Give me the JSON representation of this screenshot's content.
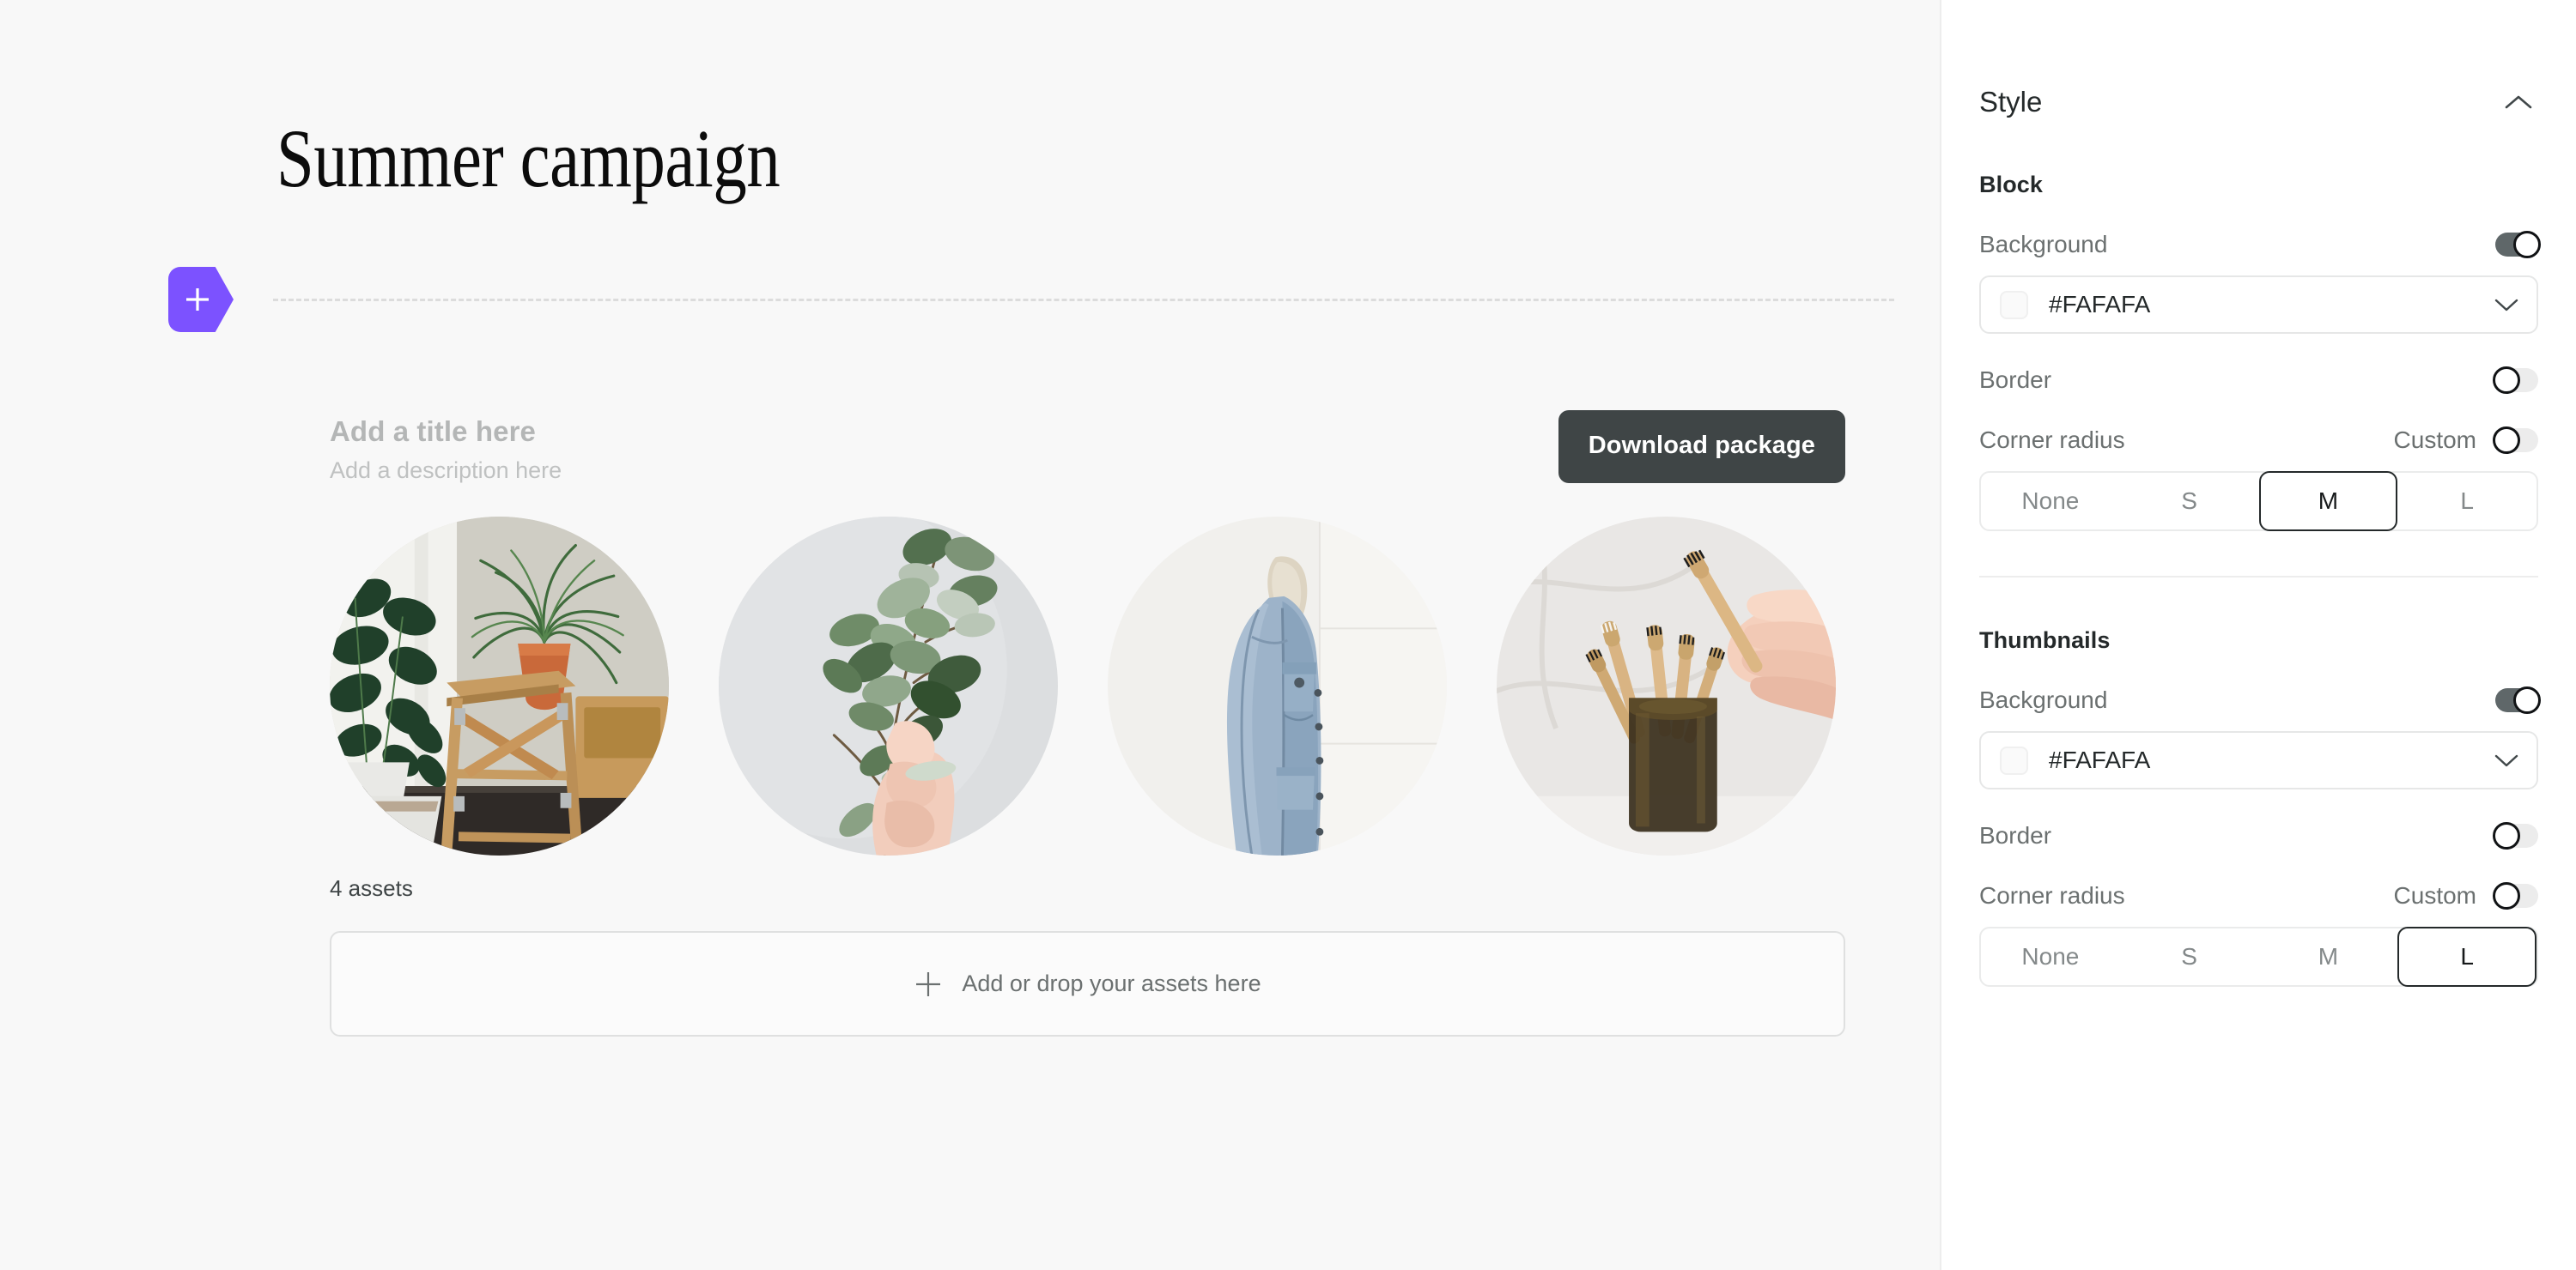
{
  "canvas": {
    "campaign_title": "Summer campaign",
    "add_block_tag": {
      "icon": "plus-icon",
      "accent_color": "#7C52FF"
    },
    "block": {
      "title_placeholder": "Add a title here",
      "description_placeholder": "Add a description here",
      "download_label": "Download package",
      "assets_count_label": "4 assets",
      "dropzone": {
        "icon": "plus-icon",
        "label": "Add or drop your assets here"
      },
      "thumbnails": [
        {
          "name": "houseplants-and-wooden-stool",
          "alt": "Indoor plants beside a wooden step stool"
        },
        {
          "name": "hand-holding-eucalyptus-branch",
          "alt": "Hand holding a eucalyptus branch on gray background"
        },
        {
          "name": "denim-jacket-on-wall",
          "alt": "Denim jacket with sherpa collar hanging on a white wall"
        },
        {
          "name": "bamboo-toothbrushes-in-jar",
          "alt": "Hand taking a bamboo toothbrush from a dark glass jar"
        }
      ]
    },
    "background_color": "#F8F8F8"
  },
  "panel": {
    "title": "Style",
    "collapse_icon": "chevron-up-icon",
    "sections": [
      {
        "name": "block",
        "heading": "Block",
        "background": {
          "label": "Background",
          "enabled": true,
          "color_value": "#FAFAFA",
          "swatch_color": "#FAFAFA",
          "chevron_icon": "chevron-down-icon"
        },
        "border": {
          "label": "Border",
          "enabled": false
        },
        "corner_radius": {
          "label": "Corner radius",
          "custom_label": "Custom",
          "custom_enabled": false,
          "options": [
            "None",
            "S",
            "M",
            "L"
          ],
          "selected": "M"
        }
      },
      {
        "name": "thumbnails",
        "heading": "Thumbnails",
        "background": {
          "label": "Background",
          "enabled": true,
          "color_value": "#FAFAFA",
          "swatch_color": "#FAFAFA",
          "chevron_icon": "chevron-down-icon"
        },
        "border": {
          "label": "Border",
          "enabled": false
        },
        "corner_radius": {
          "label": "Corner radius",
          "custom_label": "Custom",
          "custom_enabled": false,
          "options": [
            "None",
            "S",
            "M",
            "L"
          ],
          "selected": "L"
        }
      }
    ]
  }
}
